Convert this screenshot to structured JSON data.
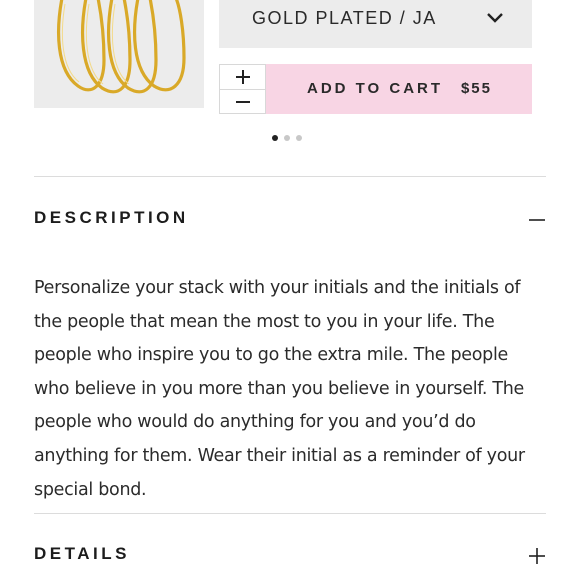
{
  "product": {
    "variant_selected": "GOLD PLATED / JA",
    "add_to_cart_label": "ADD TO CART",
    "price": "$55",
    "qty_plus": "+",
    "qty_minus": "−"
  },
  "carousel": {
    "total_slides": 3,
    "active_index": 0
  },
  "sections": {
    "description": {
      "title": "DESCRIPTION",
      "expanded": true,
      "body": "Personalize your stack with your initials and the initials of the people that mean the most to you in your life. The people who inspire you to go the extra mile. The people who believe in you more than you believe in yourself. The people who would do anything for you and you’d do anything for them. Wear their initial as a reminder of your special bond."
    },
    "details": {
      "title": "DETAILS",
      "expanded": false
    }
  },
  "icons": {
    "variant_dropdown": "chevron-down-icon",
    "description_toggle": "minus-icon",
    "details_toggle": "plus-icon"
  },
  "colors": {
    "add_to_cart_bg": "#f8d5e4",
    "select_bg": "#ececec",
    "ring_gold": "#d9a928"
  }
}
